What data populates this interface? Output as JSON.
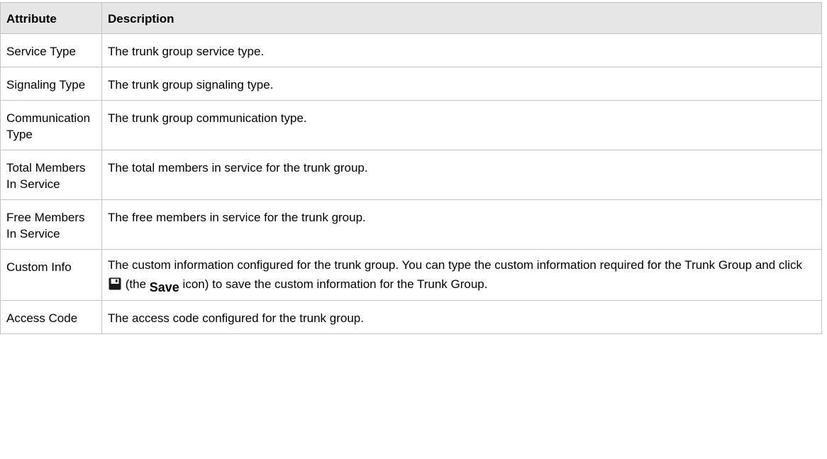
{
  "table": {
    "headers": [
      "Attribute",
      "Description"
    ],
    "rows": [
      {
        "attribute": "Service Type",
        "description": "The trunk group service type."
      },
      {
        "attribute": "Signaling Type",
        "description": "The trunk group signaling type."
      },
      {
        "attribute": "Communication Type",
        "description": "The trunk group communication type."
      },
      {
        "attribute": "Total Members In Service",
        "description": "The total members in service for the trunk group."
      },
      {
        "attribute": "Free Members In Service",
        "description": "The free members in service for the trunk group."
      },
      {
        "attribute": "Custom Info",
        "description_part1": "The custom information configured for the trunk group. You can type the custom information required for the Trunk Group and click",
        "description_part2": "(the",
        "description_bold": "Save",
        "description_part3": "icon) to save the custom information for the Trunk Group.",
        "icon": "save-icon"
      },
      {
        "attribute": "Access Code",
        "description": "The access code configured for the trunk group."
      }
    ]
  }
}
